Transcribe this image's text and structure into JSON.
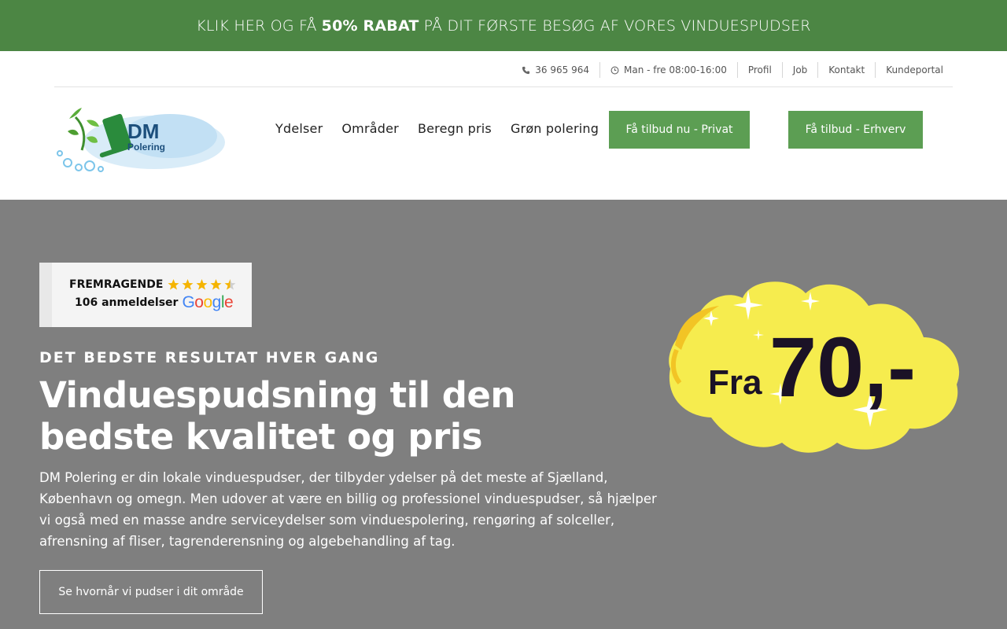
{
  "promo": {
    "pre": "KLIK HER OG FÅ",
    "bold": "50% RABAT",
    "post": "PÅ DIT FØRSTE BESØG AF VORES VINDUESPUDSER"
  },
  "topbar": {
    "phone": "36 965 964",
    "hours": "Man - fre 08:00-16:00",
    "links": [
      "Profil",
      "Job",
      "Kontakt",
      "Kundeportal"
    ]
  },
  "logo": {
    "line1": "DM",
    "line2": "Polering"
  },
  "nav": [
    "Ydelser",
    "Områder",
    "Beregn pris",
    "Grøn polering"
  ],
  "buttons": {
    "privat": "Få tilbud nu - Privat",
    "erhverv": "Få tilbud - Erhverv"
  },
  "review": {
    "rating_label": "FREMRAGENDE",
    "count_label": "106 anmeldelser",
    "stars": 4.5,
    "star_color": "#f5b400",
    "google_letters": [
      "G",
      "o",
      "o",
      "g",
      "l",
      "e"
    ],
    "google_colors": [
      "#4285F4",
      "#EA4335",
      "#FBBC05",
      "#4285F4",
      "#34A853",
      "#EA4335"
    ]
  },
  "hero": {
    "eyebrow": "DET BEDSTE RESULTAT HVER GANG",
    "title": "Vinduespudsning til den bedste kvalitet og pris",
    "text": "DM Polering er din lokale vinduespudser, der tilbyder ydelser på det meste af Sjælland, København og omegn. Men udover at være en billig og professionel vinduespudser, så hjælper vi også med en masse andre serviceydelser som vinduespolering, rengøring af solceller, afrensning af fliser, tagrenderensning og algebehandling af tag.",
    "cta": "Se hvornår vi pudser i dit område"
  },
  "price_badge": {
    "prefix": "Fra",
    "amount": "70,-"
  },
  "colors": {
    "promo_bg": "#4c8644",
    "button_green": "#5c9e53",
    "hero_bg": "#7f7f7f",
    "badge_yellow": "#f6ec4e"
  }
}
